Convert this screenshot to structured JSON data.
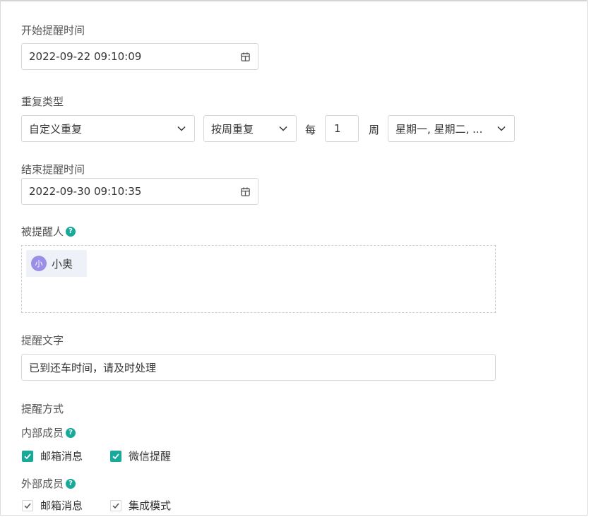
{
  "start_time": {
    "label": "开始提醒时间",
    "value": "2022-09-22 09:10:09",
    "icon": "calendar-icon"
  },
  "repeat": {
    "label": "重复类型",
    "type_value": "自定义重复",
    "unit_value": "按周重复",
    "every_label": "每",
    "interval_value": "1",
    "period_label": "周",
    "days_value": "星期一, 星期二, ..."
  },
  "end_time": {
    "label": "结束提醒时间",
    "value": "2022-09-30 09:10:35",
    "icon": "calendar-icon"
  },
  "recipients": {
    "label": "被提醒人",
    "users": [
      {
        "avatar_text": "小",
        "name": "小奥"
      }
    ]
  },
  "message": {
    "label": "提醒文字",
    "value": "已到还车时间，请及时处理"
  },
  "methods": {
    "label": "提醒方式",
    "internal": {
      "label": "内部成员",
      "options": [
        {
          "label": "邮箱消息",
          "checked": true
        },
        {
          "label": "微信提醒",
          "checked": true
        }
      ]
    },
    "external": {
      "label": "外部成员",
      "options": [
        {
          "label": "邮箱消息",
          "checked": false
        },
        {
          "label": "集成模式",
          "checked": false
        }
      ]
    }
  },
  "colors": {
    "accent": "#17a99a",
    "avatar": "#9b8ee6",
    "border": "#d6d6d6",
    "chip_bg": "#eef1f8"
  }
}
